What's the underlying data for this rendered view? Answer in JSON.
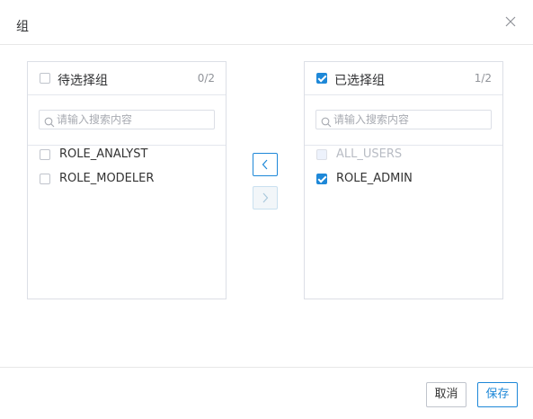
{
  "dialog": {
    "title": "组",
    "close_icon": "close-icon"
  },
  "left_panel": {
    "title": "待选择组",
    "count": "0/2",
    "all_checked": false,
    "search_placeholder": "请输入搜索内容",
    "items": [
      {
        "label": "ROLE_ANALYST",
        "checked": false,
        "disabled": false
      },
      {
        "label": "ROLE_MODELER",
        "checked": false,
        "disabled": false
      }
    ]
  },
  "right_panel": {
    "title": "已选择组",
    "count": "1/2",
    "all_checked": true,
    "search_placeholder": "请输入搜索内容",
    "items": [
      {
        "label": "ALL_USERS",
        "checked": false,
        "disabled": true
      },
      {
        "label": "ROLE_ADMIN",
        "checked": true,
        "disabled": false
      }
    ]
  },
  "transfer": {
    "to_left_icon": "chevron-left-icon",
    "to_right_icon": "chevron-right-icon",
    "to_right_disabled": true
  },
  "footer": {
    "cancel_label": "取消",
    "save_label": "保存"
  },
  "colors": {
    "accent": "#1e88d8",
    "border": "#dcdfe6",
    "disabled_text": "#b8bcc4"
  }
}
